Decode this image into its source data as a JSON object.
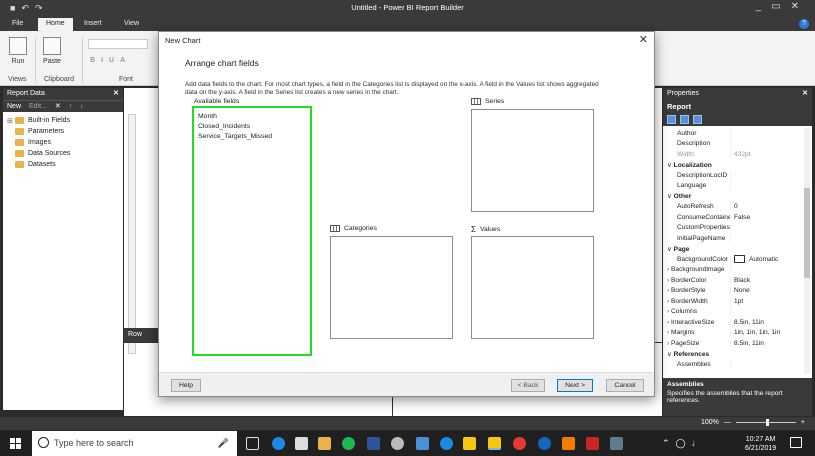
{
  "app": {
    "title": "Untitled - Power BI Report Builder",
    "tabs": [
      "File",
      "Home",
      "Insert",
      "View"
    ],
    "active_tab": "Home",
    "help_glyph": "?"
  },
  "ribbon": {
    "run_label": "Run",
    "paste_label": "Paste",
    "groups": {
      "views": "Views",
      "clipboard": "Clipboard",
      "font": "Font"
    },
    "font_buttons": [
      "B",
      "I",
      "U",
      "A"
    ]
  },
  "report_data": {
    "header": "Report Data",
    "toolbar": [
      "New",
      "Edit...",
      "✕",
      "↑",
      "↓"
    ],
    "items": [
      "Built-in Fields",
      "Parameters",
      "Images",
      "Data Sources",
      "Datasets"
    ]
  },
  "design": {
    "row_groups_label": "Row"
  },
  "properties": {
    "header": "Properties",
    "object": "Report",
    "rows": [
      {
        "name": "Author",
        "value": "",
        "type": "prop"
      },
      {
        "name": "Description",
        "value": "",
        "type": "prop"
      },
      {
        "name": "Width",
        "value": "432pt",
        "type": "muted"
      },
      {
        "name": "Localization",
        "value": "",
        "type": "cat"
      },
      {
        "name": "DescriptionLocID",
        "value": "",
        "type": "prop"
      },
      {
        "name": "Language",
        "value": "",
        "type": "prop"
      },
      {
        "name": "Other",
        "value": "",
        "type": "cat"
      },
      {
        "name": "AutoRefresh",
        "value": "0",
        "type": "prop"
      },
      {
        "name": "ConsumeContainer",
        "value": "False",
        "type": "prop"
      },
      {
        "name": "CustomProperties",
        "value": "",
        "type": "prop"
      },
      {
        "name": "InitialPageName",
        "value": "",
        "type": "prop"
      },
      {
        "name": "Page",
        "value": "",
        "type": "cat"
      },
      {
        "name": "BackgroundColor",
        "value": "Automatic",
        "type": "swatch"
      },
      {
        "name": "BackgroundImage",
        "value": "",
        "type": "collapsed"
      },
      {
        "name": "BorderColor",
        "value": "Black",
        "type": "collapsed"
      },
      {
        "name": "BorderStyle",
        "value": "None",
        "type": "collapsed"
      },
      {
        "name": "BorderWidth",
        "value": "1pt",
        "type": "collapsed"
      },
      {
        "name": "Columns",
        "value": "",
        "type": "collapsed"
      },
      {
        "name": "InteractiveSize",
        "value": "8.5in, 11in",
        "type": "collapsed"
      },
      {
        "name": "Margins",
        "value": "1in, 1in, 1in, 1in",
        "type": "collapsed"
      },
      {
        "name": "PageSize",
        "value": "8.5in, 11in",
        "type": "collapsed"
      },
      {
        "name": "References",
        "value": "",
        "type": "cat"
      },
      {
        "name": "Assemblies",
        "value": "",
        "type": "prop"
      }
    ],
    "desc_title": "Assemblies",
    "desc_text": "Specifies the assemblies that the report references."
  },
  "statusbar": {
    "zoom": "100%"
  },
  "dialog": {
    "title": "New Chart",
    "heading": "Arrange chart fields",
    "instructions": "Add data fields to the chart. For most chart types, a field in the Categories list is displayed on the x-axis. A field in the Values list shows aggregated data on the y-axis. A field in the Series list creates a new series in the chart.",
    "available_label": "Available fields",
    "available_fields": [
      "Month",
      "Closed_Incidents",
      "Service_Targets_Missed"
    ],
    "series_label": "Series",
    "categories_label": "Categories",
    "values_label": "Values",
    "highlight_color": "#22dd22",
    "buttons": {
      "help": "Help",
      "back": "< Back",
      "next": "Next >",
      "cancel": "Cancel"
    }
  },
  "taskbar": {
    "search_placeholder": "Type here to search",
    "time": "10:27 AM",
    "date": "6/21/2019"
  }
}
